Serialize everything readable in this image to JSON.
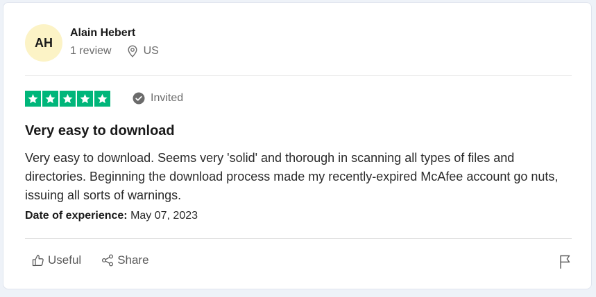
{
  "reviewer": {
    "initials": "AH",
    "name": "Alain Hebert",
    "review_count": "1 review",
    "country": "US",
    "avatar_color": "#fcf3c6"
  },
  "rating": {
    "stars": 5,
    "max_stars": 5,
    "star_color": "#00b67a",
    "status_icon": "check-circle-icon",
    "status": "Invited"
  },
  "review": {
    "title": "Very easy to download",
    "body": "Very easy to download. Seems very 'solid' and thorough in scanning all types of files and directories. Beginning the download process made my recently-expired McAfee account go nuts, issuing all sorts of warnings.",
    "experience_label": "Date of experience:",
    "experience_date": "May 07, 2023"
  },
  "actions": {
    "useful_label": "Useful",
    "useful_icon": "thumbs-up-icon",
    "share_label": "Share",
    "share_icon": "share-icon",
    "report_icon": "flag-icon"
  }
}
